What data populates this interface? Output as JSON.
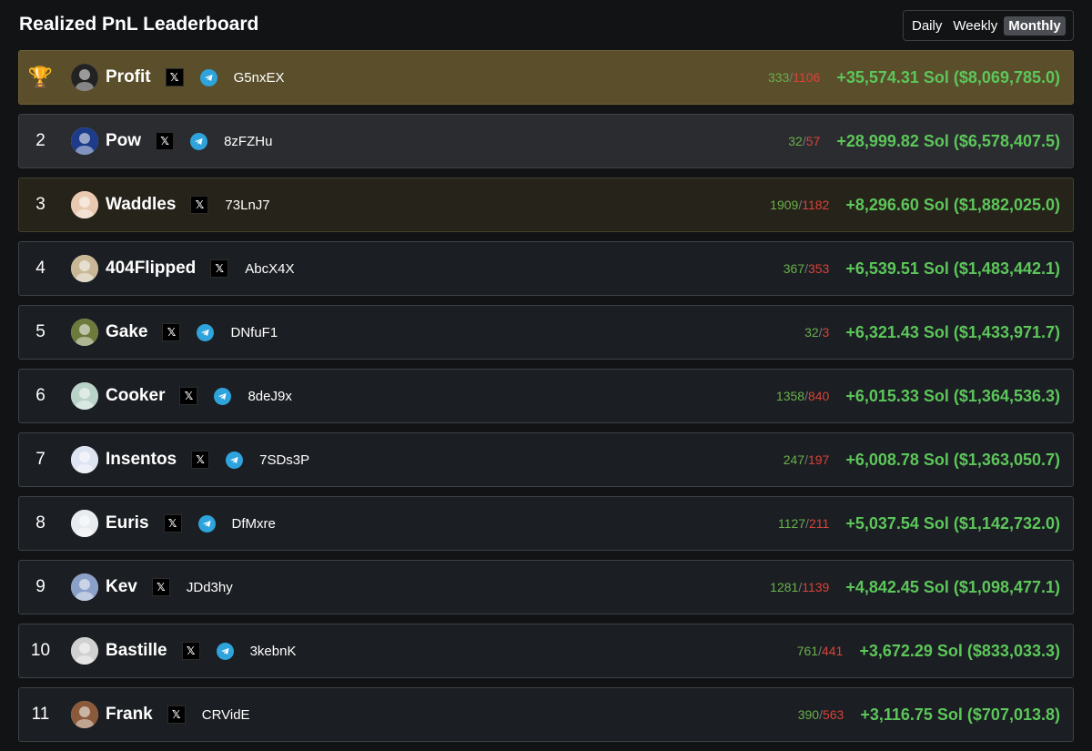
{
  "header": {
    "title": "Realized PnL Leaderboard",
    "periods": [
      "Daily",
      "Weekly",
      "Monthly"
    ],
    "active_period": "Monthly"
  },
  "rows": [
    {
      "rank": "🏆",
      "name": "Profit",
      "has_x": true,
      "has_telegram": true,
      "address": "G5nxEX",
      "wins": "333",
      "losses": "1106",
      "pnl": "+35,574.31 Sol ($8,069,785.0)",
      "style": "gold",
      "avatar_color": "#222"
    },
    {
      "rank": "2",
      "name": "Pow",
      "has_x": true,
      "has_telegram": true,
      "address": "8zFZHu",
      "wins": "32",
      "losses": "57",
      "pnl": "+28,999.82 Sol ($6,578,407.5)",
      "style": "pale",
      "avatar_color": "#1c3b8a"
    },
    {
      "rank": "3",
      "name": "Waddles",
      "has_x": true,
      "has_telegram": false,
      "address": "73LnJ7",
      "wins": "1909",
      "losses": "1182",
      "pnl": "+8,296.60 Sol ($1,882,025.0)",
      "style": "bronze",
      "avatar_color": "#e9c9b0"
    },
    {
      "rank": "4",
      "name": "404Flipped",
      "has_x": true,
      "has_telegram": false,
      "address": "AbcX4X",
      "wins": "367",
      "losses": "353",
      "pnl": "+6,539.51 Sol ($1,483,442.1)",
      "style": "",
      "avatar_color": "#c8b896"
    },
    {
      "rank": "5",
      "name": "Gake",
      "has_x": true,
      "has_telegram": true,
      "address": "DNfuF1",
      "wins": "32",
      "losses": "3",
      "pnl": "+6,321.43 Sol ($1,433,971.7)",
      "style": "",
      "avatar_color": "#6d7a3c"
    },
    {
      "rank": "6",
      "name": "Cooker",
      "has_x": true,
      "has_telegram": true,
      "address": "8deJ9x",
      "wins": "1358",
      "losses": "840",
      "pnl": "+6,015.33 Sol ($1,364,536.3)",
      "style": "",
      "avatar_color": "#b9d3c8"
    },
    {
      "rank": "7",
      "name": "Insentos",
      "has_x": true,
      "has_telegram": true,
      "address": "7SDs3P",
      "wins": "247",
      "losses": "197",
      "pnl": "+6,008.78 Sol ($1,363,050.7)",
      "style": "",
      "avatar_color": "#dfe4f2"
    },
    {
      "rank": "8",
      "name": "Euris",
      "has_x": true,
      "has_telegram": true,
      "address": "DfMxre",
      "wins": "1127",
      "losses": "211",
      "pnl": "+5,037.54 Sol ($1,142,732.0)",
      "style": "",
      "avatar_color": "#e8ecef"
    },
    {
      "rank": "9",
      "name": "Kev",
      "has_x": true,
      "has_telegram": false,
      "address": "JDd3hy",
      "wins": "1281",
      "losses": "1139",
      "pnl": "+4,842.45 Sol ($1,098,477.1)",
      "style": "",
      "avatar_color": "#8aa0c8"
    },
    {
      "rank": "10",
      "name": "Bastille",
      "has_x": true,
      "has_telegram": true,
      "address": "3kebnK",
      "wins": "761",
      "losses": "441",
      "pnl": "+3,672.29 Sol ($833,033.3)",
      "style": "",
      "avatar_color": "#d0d0d0"
    },
    {
      "rank": "11",
      "name": "Frank",
      "has_x": true,
      "has_telegram": false,
      "address": "CRVidE",
      "wins": "390",
      "losses": "563",
      "pnl": "+3,116.75 Sol ($707,013.8)",
      "style": "",
      "avatar_color": "#8a5a3a"
    }
  ]
}
